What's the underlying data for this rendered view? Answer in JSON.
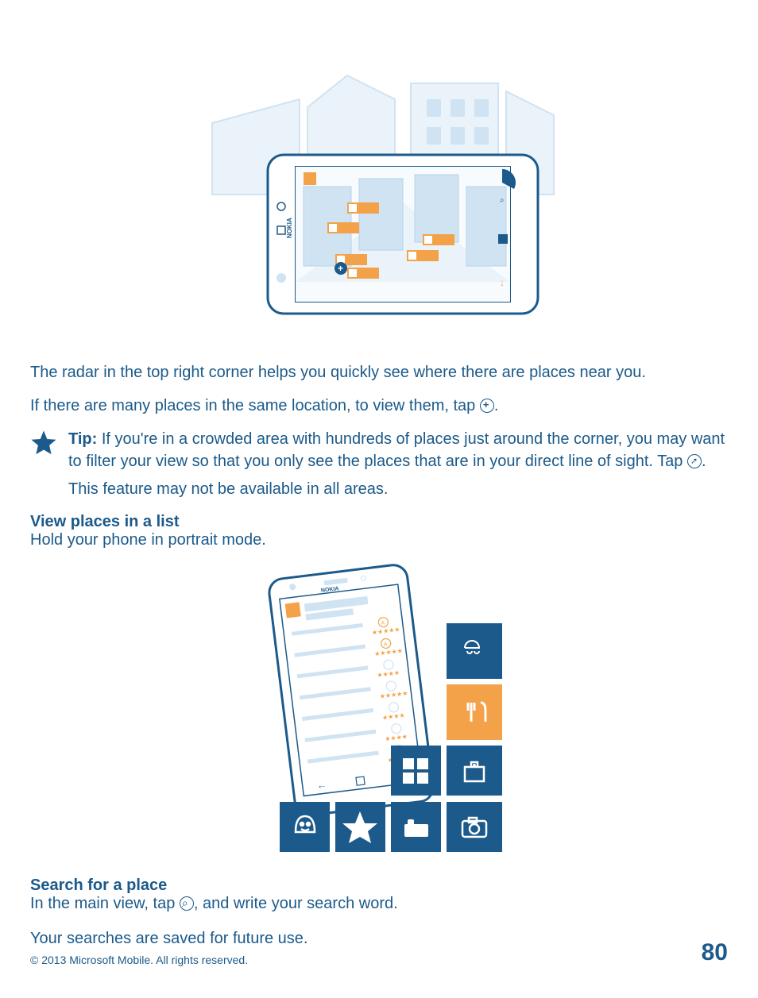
{
  "colors": {
    "primary": "#1b5a8a",
    "accent": "#f4a24a",
    "light": "#cfe3f2"
  },
  "hero": {
    "brand": "NOKIA"
  },
  "body": {
    "para1": "The radar in the top right corner helps you quickly see where there are places near you.",
    "para2_before": "If there are many places in the same location, to view them, tap ",
    "para2_after": ".",
    "tip_label": "Tip:",
    "tip_text_before": " If you're in a crowded area with hundreds of places just around the corner, you may want to filter your view so that you only see the places that are in your direct line of sight. Tap ",
    "tip_text_after": ".",
    "tip_note": "This feature may not be available in all areas."
  },
  "sections": {
    "view_list": {
      "heading": "View places in a list",
      "body": "Hold your phone in portrait mode."
    },
    "search": {
      "heading": "Search for a place",
      "body_before": "In the main view, tap ",
      "body_after": ", and write your search word.",
      "body2": "Your searches are saved for future use."
    }
  },
  "footer": {
    "copyright": "© 2013 Microsoft Mobile. All rights reserved.",
    "page": "80"
  }
}
